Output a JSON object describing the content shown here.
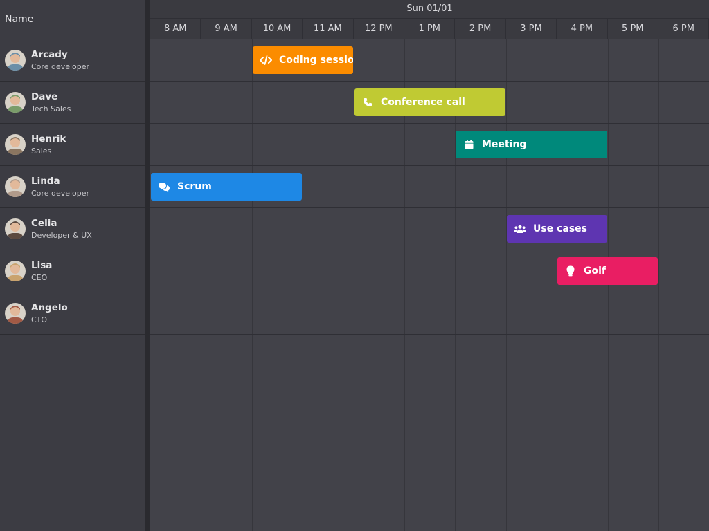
{
  "left_header": {
    "title": "Name"
  },
  "timeline": {
    "day_label": "Sun 01/01",
    "hours": [
      "8 AM",
      "9 AM",
      "10 AM",
      "11 AM",
      "12 PM",
      "1 PM",
      "2 PM",
      "3 PM",
      "4 PM",
      "5 PM",
      "6 PM"
    ]
  },
  "resources": [
    {
      "name": "Arcady",
      "role": "Core developer",
      "avatar_color": "#6b8fa8"
    },
    {
      "name": "Dave",
      "role": "Tech Sales",
      "avatar_color": "#7a9c6a"
    },
    {
      "name": "Henrik",
      "role": "Sales",
      "avatar_color": "#8a7560"
    },
    {
      "name": "Linda",
      "role": "Core developer",
      "avatar_color": "#b09a8a"
    },
    {
      "name": "Celia",
      "role": "Developer & UX",
      "avatar_color": "#5c4a40"
    },
    {
      "name": "Lisa",
      "role": "CEO",
      "avatar_color": "#c9a36e"
    },
    {
      "name": "Angelo",
      "role": "CTO",
      "avatar_color": "#a25a45"
    }
  ],
  "events": [
    {
      "title": "Coding session",
      "resource": 0,
      "start": "10 AM",
      "end": "12 PM",
      "color": "#fb8c00",
      "icon": "code-icon"
    },
    {
      "title": "Conference call",
      "resource": 1,
      "start": "12 PM",
      "end": "3 PM",
      "color": "#c0ca33",
      "icon": "phone-icon"
    },
    {
      "title": "Meeting",
      "resource": 2,
      "start": "2 PM",
      "end": "5 PM",
      "color": "#00897b",
      "icon": "calendar-icon"
    },
    {
      "title": "Scrum",
      "resource": 3,
      "start": "8 AM",
      "end": "11 AM",
      "color": "#1e88e5",
      "icon": "chat-icon"
    },
    {
      "title": "Use cases",
      "resource": 4,
      "start": "3 PM",
      "end": "5 PM",
      "color": "#5e35b1",
      "icon": "users-icon"
    },
    {
      "title": "Golf",
      "resource": 5,
      "start": "4 PM",
      "end": "6 PM",
      "color": "#e91e63",
      "icon": "lightbulb-icon"
    }
  ]
}
